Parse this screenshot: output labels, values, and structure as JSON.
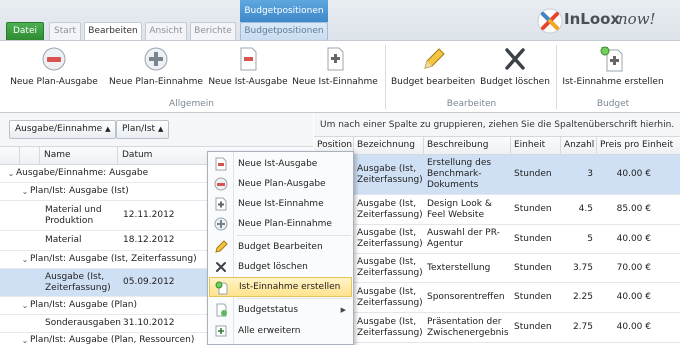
{
  "ribbon_tabs": {
    "file": "Datei",
    "start": "Start",
    "edit": "Bearbeiten",
    "view": "Ansicht",
    "reports": "Berichte",
    "context_group": "Budgetpositionen",
    "context_tab": "Budgetpositionen"
  },
  "logo": {
    "brand": "InLoox",
    "suffix": "now!"
  },
  "ribbon": {
    "btn_neue_plan_ausgabe": "Neue Plan-Ausgabe",
    "btn_neue_plan_einnahme": "Neue Plan-Einnahme",
    "btn_neue_ist_ausgabe": "Neue Ist-Ausgabe",
    "btn_neue_ist_einnahme": "Neue Ist-Einnahme",
    "group_allgemein": "Allgemein",
    "btn_budget_bearbeiten": "Budget bearbeiten",
    "btn_budget_loeschen": "Budget löschen",
    "group_bearbeiten": "Bearbeiten",
    "btn_ist_einnahme_erstellen": "Ist-Einnahme erstellen",
    "group_budget": "Budget"
  },
  "left": {
    "chip1": "Ausgabe/Einnahme",
    "chip2": "Plan/Ist",
    "col_name": "Name",
    "col_datum": "Datum",
    "rows": [
      {
        "name": "Ausgabe/Einnahme: Ausgabe",
        "date": ""
      },
      {
        "name": "Plan/Ist: Ausgabe (Ist)",
        "date": ""
      },
      {
        "name": "Material und Produktion",
        "date": "12.11.2012"
      },
      {
        "name": "Material",
        "date": "18.12.2012"
      },
      {
        "name": "Plan/Ist: Ausgabe (Ist, Zeiterfassung)",
        "date": ""
      },
      {
        "name": "Ausgabe (Ist, Zeiterfassung)",
        "date": "05.09.2012"
      },
      {
        "name": "Plan/Ist: Ausgabe (Plan)",
        "date": ""
      },
      {
        "name": "Sonderausgaben",
        "date": "31.10.2012"
      },
      {
        "name": "Plan/Ist: Ausgabe (Plan, Ressourcen)",
        "date": ""
      }
    ]
  },
  "right": {
    "hint": "Um nach einer Spalte zu gruppieren, ziehen Sie die Spaltenüberschrift hierhin.",
    "col_position": "Position",
    "col_bezeichnung": "Bezeichnung",
    "col_beschreibung": "Beschreibung",
    "col_einheit": "Einheit",
    "col_anzahl": "Anzahl",
    "col_preis": "Preis pro Einheit",
    "rows": [
      {
        "bez": "Ausgabe (Ist, Zeiterfassung)",
        "desc": "Erstellung des Benchmark-Dokuments",
        "unit": "Stunden",
        "qty": "3",
        "price": "40.00 €"
      },
      {
        "bez": "Ausgabe (Ist, Zeiterfassung)",
        "desc": "Design Look & Feel Website",
        "unit": "Stunden",
        "qty": "4.5",
        "price": "85.00 €"
      },
      {
        "bez": "Ausgabe (Ist, Zeiterfassung)",
        "desc": "Auswahl der PR-Agentur",
        "unit": "Stunden",
        "qty": "5",
        "price": "40.00 €"
      },
      {
        "bez": "Ausgabe (Ist, Zeiterfassung)",
        "desc": "Texterstellung",
        "unit": "Stunden",
        "qty": "3.75",
        "price": "70.00 €"
      },
      {
        "bez": "Ausgabe (Ist, Zeiterfassung)",
        "desc": "Sponsorentreffen",
        "unit": "Stunden",
        "qty": "2.25",
        "price": "40.00 €"
      },
      {
        "bez": "Ausgabe (Ist, Zeiterfassung)",
        "desc": "Präsentation der Zwischenergebnisse",
        "unit": "Stunden",
        "qty": "2.75",
        "price": "40.00 €"
      }
    ]
  },
  "context_menu": {
    "items": [
      "Neue Ist-Ausgabe",
      "Neue Plan-Ausgabe",
      "Neue Ist-Einnahme",
      "Neue Plan-Einnahme",
      "Budget Bearbeiten",
      "Budget löschen",
      "Ist-Einnahme erstellen",
      "Budgetstatus",
      "Alle erweitern"
    ]
  },
  "colors": {
    "accent": "#3e88c9",
    "green": "#2e8b32",
    "selection": "#cfe0f4",
    "highlight": "#ffe38c"
  }
}
